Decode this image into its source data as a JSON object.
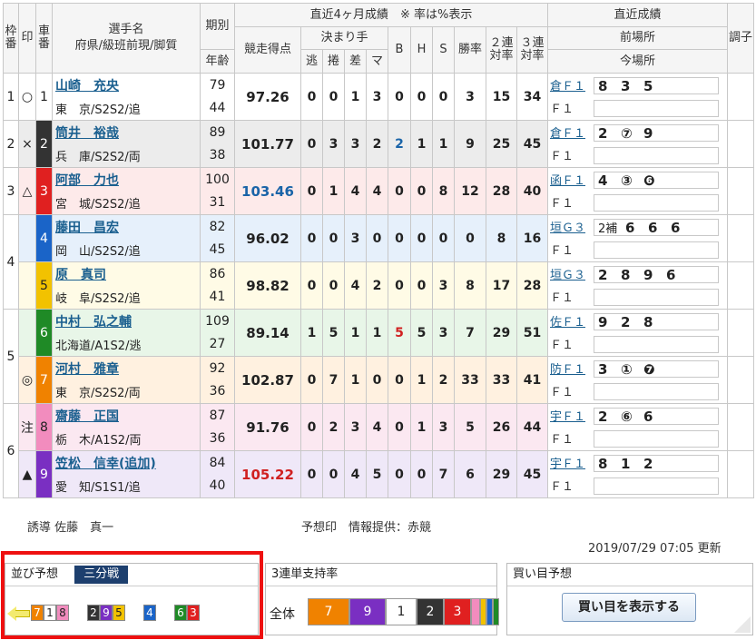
{
  "header": {
    "waku": "枠番",
    "mark": "印",
    "car": "車番",
    "name_line1": "選手名",
    "name_line2": "府県/級班前現/脚質",
    "ki": "期別",
    "age": "年齢",
    "recent4": "直近4ヶ月成績　※ 率は%表示",
    "score": "競走得点",
    "kimarite": "決まり手",
    "nige": "逃",
    "makuri": "捲",
    "sashi": "差",
    "mark_k": "マ",
    "b": "B",
    "h": "H",
    "s": "S",
    "win_rate": "勝率",
    "ren2": "２連対率",
    "ren3": "３連対率",
    "recent_results": "直近成績",
    "prev_venue": "前場所",
    "this_venue": "今場所",
    "condition": "調子"
  },
  "riders": [
    {
      "waku": "1",
      "mark": "○",
      "car": "1",
      "name": "山崎　充央",
      "pref": "東　京/S2S2/追",
      "ki": "79",
      "age": "44",
      "score": "97.26",
      "nige": "0",
      "makuri": "0",
      "sashi": "1",
      "mk": "3",
      "b": "0",
      "h": "0",
      "s": "0",
      "win": "3",
      "r2": "15",
      "r3": "34",
      "prev": "倉Ｆ１",
      "prev_res": [
        "8",
        "3",
        "5"
      ],
      "now": "Ｆ１"
    },
    {
      "waku": "2",
      "mark": "×",
      "car": "2",
      "name": "筒井　裕哉",
      "pref": "兵　庫/S2S2/両",
      "ki": "89",
      "age": "38",
      "score": "101.77",
      "nige": "0",
      "makuri": "3",
      "sashi": "3",
      "mk": "2",
      "b": "2",
      "h": "1",
      "s": "1",
      "win": "9",
      "r2": "25",
      "r3": "45",
      "prev": "倉Ｆ１",
      "prev_res": [
        "2",
        "⑦",
        "9"
      ],
      "now": "Ｆ１"
    },
    {
      "waku": "3",
      "mark": "△",
      "car": "3",
      "name": "阿部　力也",
      "pref": "宮　城/S2S2/追",
      "ki": "100",
      "age": "31",
      "score": "103.46",
      "nige": "0",
      "makuri": "1",
      "sashi": "4",
      "mk": "4",
      "b": "0",
      "h": "0",
      "s": "8",
      "win": "12",
      "r2": "28",
      "r3": "40",
      "prev": "函Ｆ１",
      "prev_res": [
        "4",
        "③",
        "❻"
      ],
      "now": "Ｆ１"
    },
    {
      "waku": "4",
      "mark": "",
      "car": "4",
      "name": "藤田　昌宏",
      "pref": "岡　山/S2S2/追",
      "ki": "82",
      "age": "45",
      "score": "96.02",
      "nige": "0",
      "makuri": "0",
      "sashi": "3",
      "mk": "0",
      "b": "0",
      "h": "0",
      "s": "0",
      "win": "0",
      "r2": "8",
      "r3": "16",
      "prev": "垣Ｇ３",
      "prev_res": [
        "2補",
        "6",
        "6",
        "6"
      ],
      "now": "Ｆ１"
    },
    {
      "waku": "",
      "mark": "",
      "car": "5",
      "name": "原　真司",
      "pref": "岐　阜/S2S2/追",
      "ki": "86",
      "age": "41",
      "score": "98.82",
      "nige": "0",
      "makuri": "0",
      "sashi": "4",
      "mk": "2",
      "b": "0",
      "h": "0",
      "s": "3",
      "win": "8",
      "r2": "17",
      "r3": "28",
      "prev": "垣Ｇ３",
      "prev_res": [
        "2",
        "8",
        "9",
        "6"
      ],
      "now": "Ｆ１"
    },
    {
      "waku": "5",
      "mark": "",
      "car": "6",
      "name": "中村　弘之輔",
      "pref": "北海道/A1S2/逃",
      "ki": "109",
      "age": "27",
      "score": "89.14",
      "nige": "1",
      "makuri": "5",
      "sashi": "1",
      "mk": "1",
      "b": "5",
      "h": "5",
      "s": "3",
      "win": "7",
      "r2": "29",
      "r3": "51",
      "prev": "佐Ｆ１",
      "prev_res": [
        "9",
        "2",
        "8"
      ],
      "now": "Ｆ１"
    },
    {
      "waku": "",
      "mark": "◎",
      "car": "7",
      "name": "河村　雅章",
      "pref": "東　京/S2S2/両",
      "ki": "92",
      "age": "36",
      "score": "102.87",
      "nige": "0",
      "makuri": "7",
      "sashi": "1",
      "mk": "0",
      "b": "0",
      "h": "1",
      "s": "2",
      "win": "33",
      "r2": "33",
      "r3": "41",
      "prev": "防Ｆ１",
      "prev_res": [
        "3",
        "①",
        "❼"
      ],
      "now": "Ｆ１"
    },
    {
      "waku": "6",
      "mark": "注",
      "car": "8",
      "name": "齋藤　正国",
      "pref": "栃　木/A1S2/両",
      "ki": "87",
      "age": "36",
      "score": "91.76",
      "nige": "0",
      "makuri": "2",
      "sashi": "3",
      "mk": "4",
      "b": "0",
      "h": "1",
      "s": "3",
      "win": "5",
      "r2": "26",
      "r3": "44",
      "prev": "宇Ｆ１",
      "prev_res": [
        "2",
        "⑥",
        "6"
      ],
      "now": "Ｆ１"
    },
    {
      "waku": "",
      "mark": "▲",
      "car": "9",
      "name": "笠松　信幸(追加)",
      "pref": "愛　知/S1S1/追",
      "ki": "84",
      "age": "40",
      "score": "105.22",
      "nige": "0",
      "makuri": "0",
      "sashi": "4",
      "mk": "5",
      "b": "0",
      "h": "0",
      "s": "7",
      "win": "6",
      "r2": "29",
      "r3": "45",
      "prev": "宇Ｆ１",
      "prev_res": [
        "8",
        "1",
        "2"
      ],
      "now": "Ｆ１"
    }
  ],
  "info": {
    "guide": "誘導 佐藤　真一",
    "mark_src": "予想印　情報提供：赤競",
    "updated": "2019/07/29 07:05 更新"
  },
  "line_panel": {
    "title": "並び予想",
    "tag": "三分戦",
    "groups": [
      [
        "7",
        "1",
        "8"
      ],
      [
        "2",
        "9",
        "5"
      ],
      [
        "4"
      ],
      [
        "6",
        "3"
      ]
    ]
  },
  "support_panel": {
    "title": "3連単支持率",
    "label": "全体",
    "order": [
      "7",
      "9",
      "1",
      "2",
      "3"
    ]
  },
  "buy_panel": {
    "title": "買い目予想",
    "button": "買い目を表示する"
  },
  "colors": {
    "highlight": "#ee1010",
    "tag_bg": "#1d3f6e",
    "link": "#1a5f8f"
  }
}
